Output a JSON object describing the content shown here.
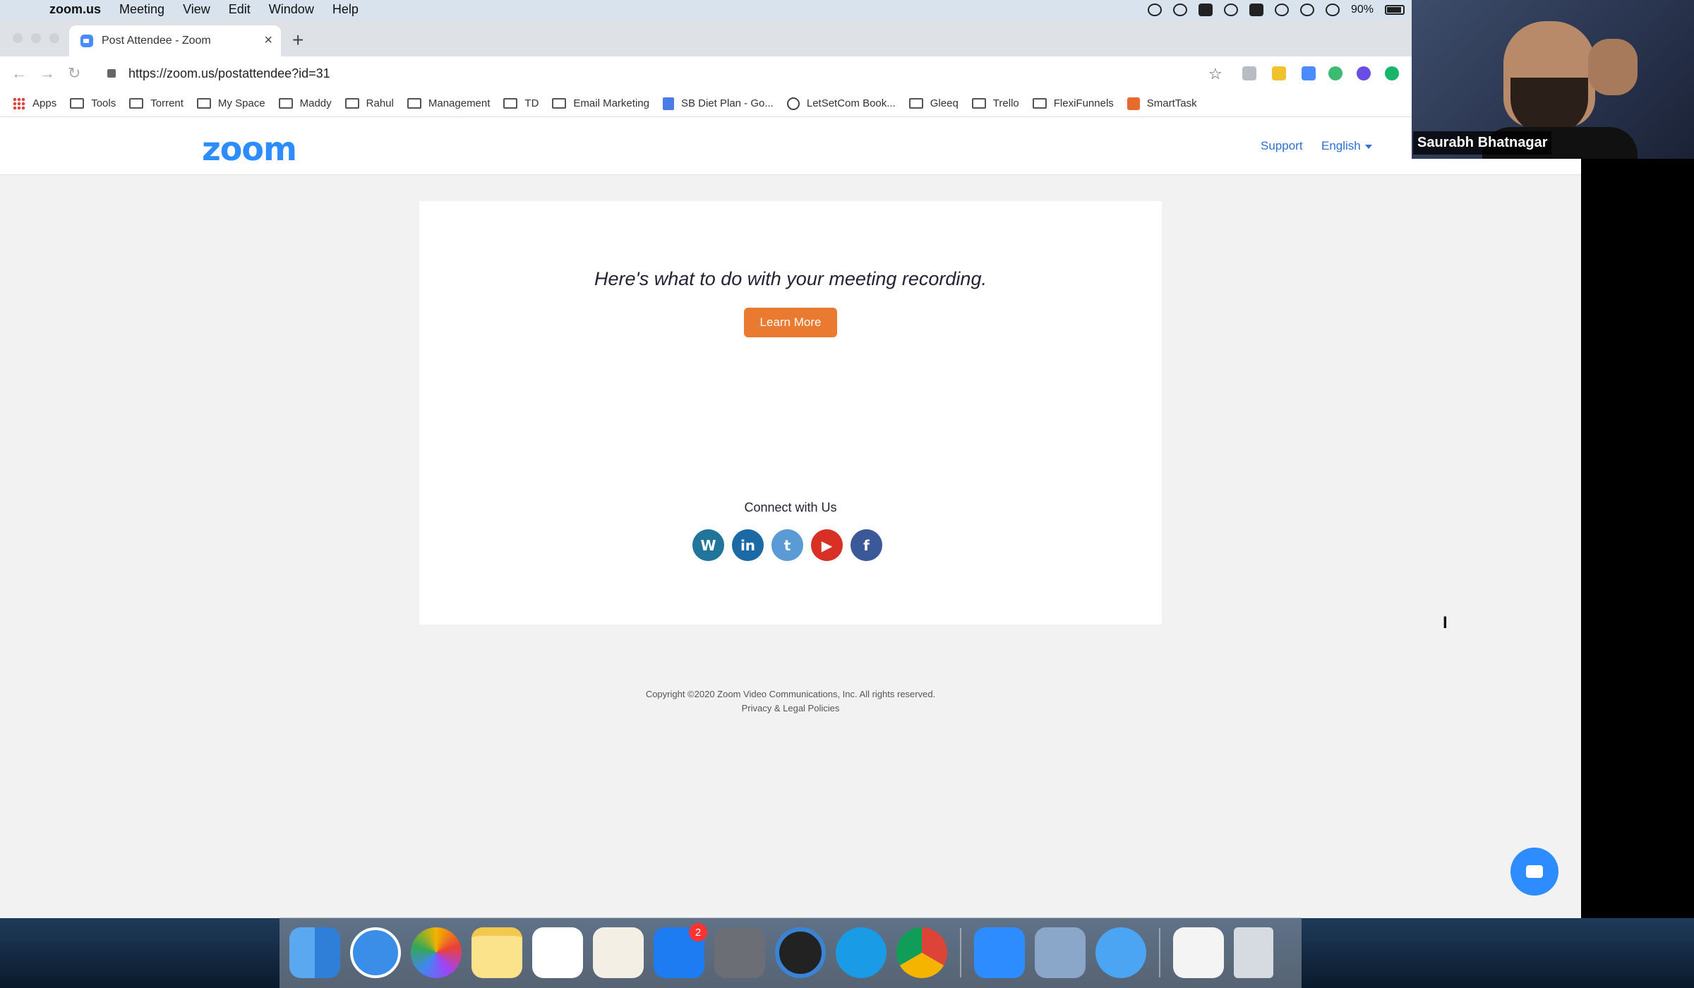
{
  "menubar": {
    "app_name": "zoom.us",
    "items": [
      "Meeting",
      "View",
      "Edit",
      "Window",
      "Help"
    ],
    "battery": "90%"
  },
  "browser": {
    "tab_title": "Post Attendee - Zoom",
    "url": "https://zoom.us/postattendee?id=31",
    "bookmarks": [
      "Apps",
      "Tools",
      "Torrent",
      "My Space",
      "Maddy",
      "Rahul",
      "Management",
      "TD",
      "Email Marketing",
      "SB Diet Plan - Go...",
      "LetSetCom Book...",
      "Gleeq",
      "Trello",
      "FlexiFunnels",
      "SmartTask"
    ]
  },
  "header": {
    "logo": "zoom",
    "support": "Support",
    "language": "English"
  },
  "main": {
    "headline": "Here's what to do with your meeting recording.",
    "learn_more": "Learn More",
    "connect": "Connect with Us"
  },
  "footer": {
    "copyright": "Copyright ©2020 Zoom Video Communications, Inc. All rights reserved.",
    "privacy": "Privacy & Legal Policies"
  },
  "video": {
    "participant": "Saurabh Bhatnagar"
  },
  "dock": {
    "app_store_badge": "2"
  },
  "colors": {
    "zoom_blue": "#2d8cff",
    "button_orange": "#ea7a2f"
  }
}
